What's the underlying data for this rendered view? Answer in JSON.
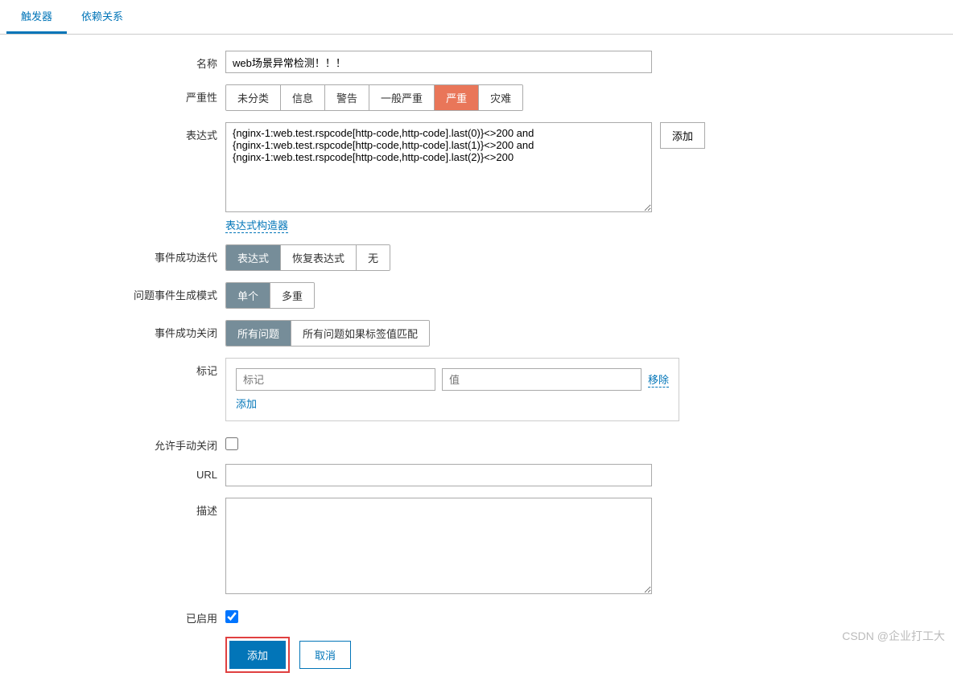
{
  "tabs": {
    "trigger": "触发器",
    "dependency": "依赖关系"
  },
  "labels": {
    "name": "名称",
    "severity": "严重性",
    "expression": "表达式",
    "eventSuccessIteration": "事件成功迭代",
    "problemEventGenMode": "问题事件生成模式",
    "eventSuccessClose": "事件成功关闭",
    "tags": "标记",
    "allowManualClose": "允许手动关闭",
    "url": "URL",
    "description": "描述",
    "enabled": "已启用"
  },
  "form": {
    "nameValue": "web场景异常检测！！！",
    "expressionValue": "{nginx-1:web.test.rspcode[http-code,http-code].last(0)}<>200 and\n{nginx-1:web.test.rspcode[http-code,http-code].last(1)}<>200 and\n{nginx-1:web.test.rspcode[http-code,http-code].last(2)}<>200",
    "urlValue": "",
    "descValue": ""
  },
  "severity": {
    "options": [
      "未分类",
      "信息",
      "警告",
      "一般严重",
      "严重",
      "灾难"
    ],
    "selected": 4
  },
  "eventSuccessIteration": {
    "options": [
      "表达式",
      "恢复表达式",
      "无"
    ],
    "selected": 0
  },
  "problemGenMode": {
    "options": [
      "单个",
      "多重"
    ],
    "selected": 0
  },
  "eventSuccessClose": {
    "options": [
      "所有问题",
      "所有问题如果标签值匹配"
    ],
    "selected": 0
  },
  "buttons": {
    "addExpr": "添加",
    "exprBuilder": "表达式构造器",
    "tagAdd": "添加",
    "tagRemove": "移除",
    "submit": "添加",
    "cancel": "取消"
  },
  "placeholders": {
    "tagName": "标记",
    "tagValue": "值"
  },
  "watermark": "CSDN @企业打工大"
}
